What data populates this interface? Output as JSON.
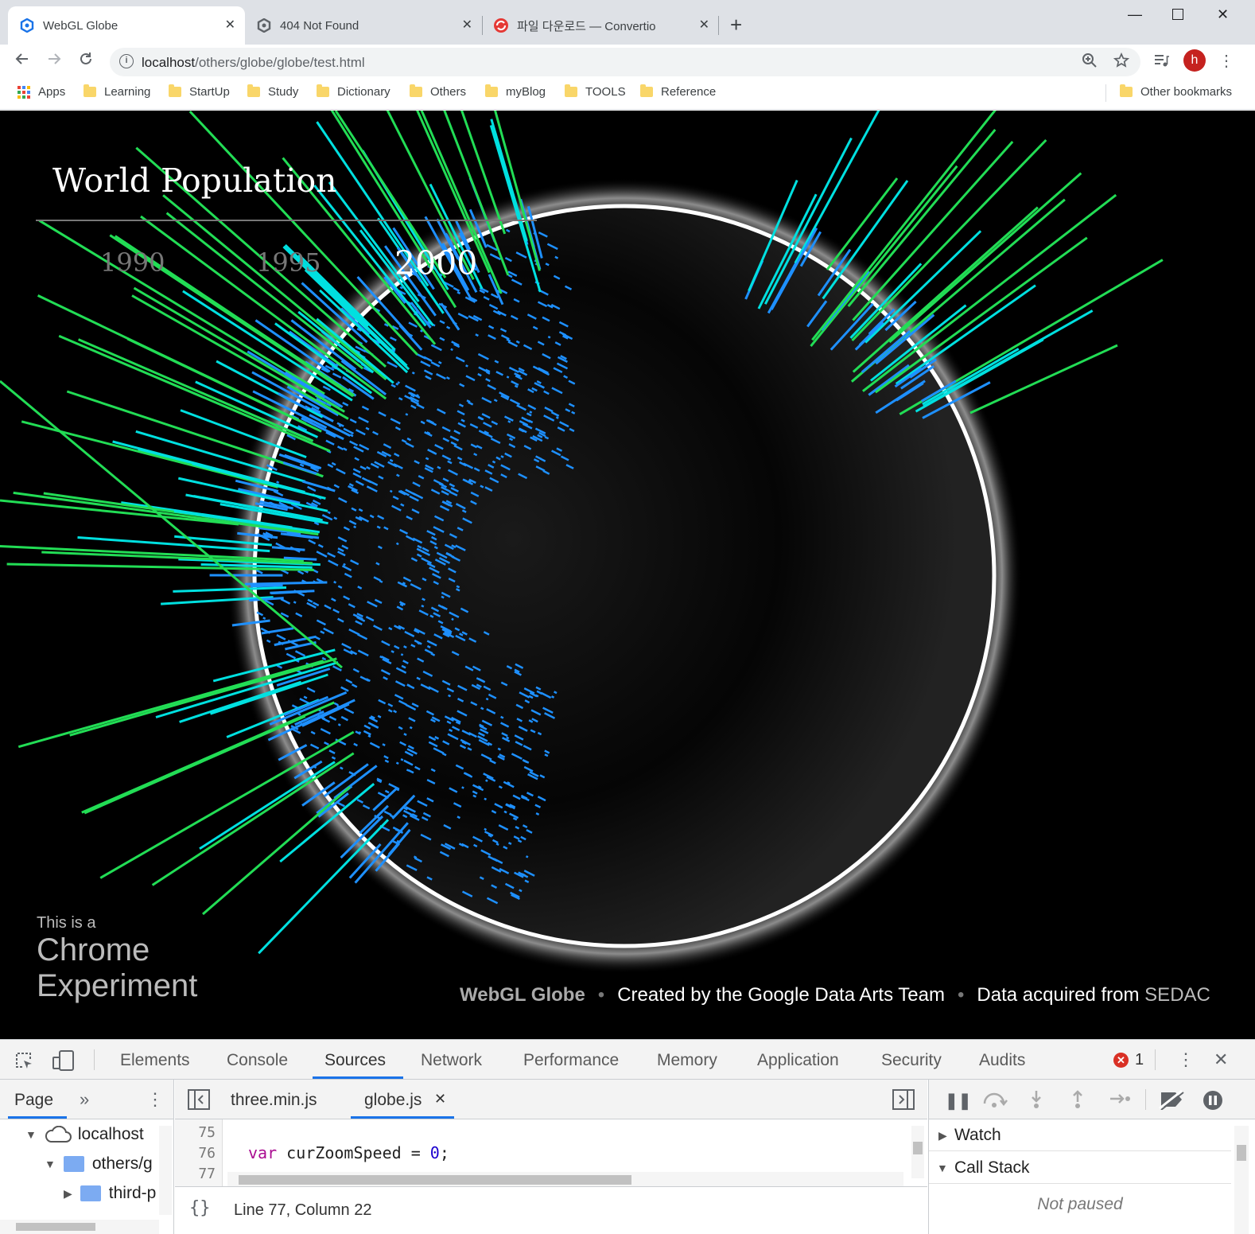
{
  "browser": {
    "tabs": [
      {
        "title": "WebGL Globe",
        "active": true
      },
      {
        "title": "404 Not Found",
        "active": false
      },
      {
        "title": "파일 다운로드 — Convertio",
        "active": false
      }
    ],
    "url_host": "localhost",
    "url_path": "/others/globe/globe/test.html",
    "profile_initial": "h",
    "bookmarks": [
      "Apps",
      "Learning",
      "StartUp",
      "Study",
      "Dictionary",
      "Others",
      "myBlog",
      "TOOLS",
      "Reference"
    ],
    "other_bookmarks": "Other bookmarks"
  },
  "page": {
    "title": "World Population",
    "years": [
      "1990",
      "1995",
      "2000"
    ],
    "selected_year": "2000",
    "chrome_experiment": {
      "line1": "This is a",
      "line2": "Chrome",
      "line3": "Experiment"
    },
    "credits": {
      "name": "WebGL Globe",
      "team": "Created by the Google Data Arts Team",
      "data_prefix": "Data acquired from",
      "source": "SEDAC"
    }
  },
  "devtools": {
    "tabs": [
      "Elements",
      "Console",
      "Sources",
      "Network",
      "Performance",
      "Memory",
      "Application",
      "Security",
      "Audits"
    ],
    "active_tab": "Sources",
    "error_count": "1",
    "navigator": {
      "tab": "Page",
      "tree": [
        "localhost",
        "others/g",
        "third-p"
      ]
    },
    "editor": {
      "files": [
        "three.min.js",
        "globe.js"
      ],
      "active_file": "globe.js",
      "line_numbers": [
        "75",
        "76",
        "77"
      ],
      "code_line_76": {
        "keyword": "var",
        "rest": " curZoomSpeed = ",
        "value": "0",
        "end": ";"
      },
      "status": "Line 77, Column 22"
    },
    "debugger": {
      "watch": "Watch",
      "call_stack": "Call Stack",
      "not_paused": "Not paused"
    }
  },
  "colors": {
    "accent": "#1a73e8",
    "bars_blue": "#1e90ff",
    "bars_cyan": "#00e0e0",
    "bars_green": "#22dd55",
    "error": "#d93025"
  }
}
